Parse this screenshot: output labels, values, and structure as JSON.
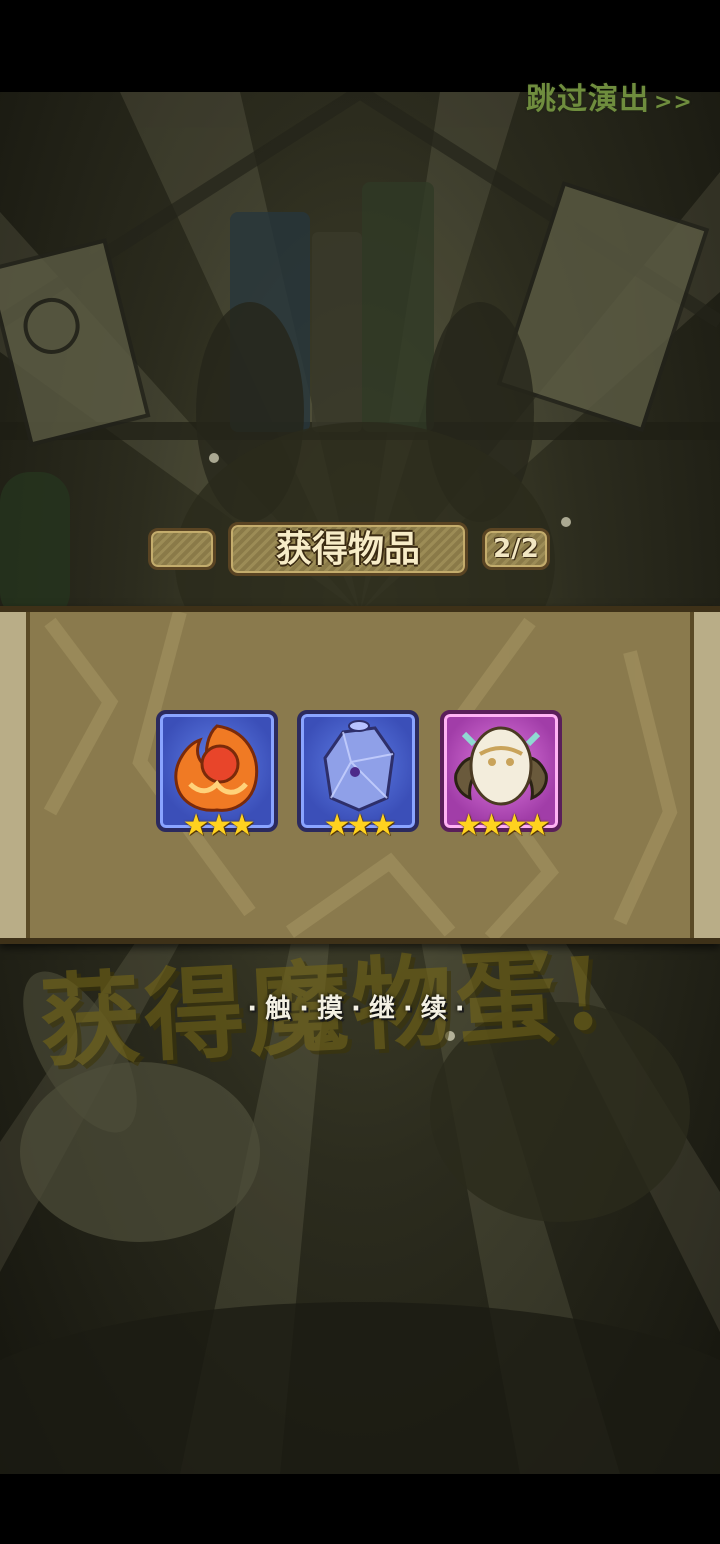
{
  "header": {
    "skip_label": "跳过演出",
    "skip_arrows": ">>"
  },
  "reward_panel": {
    "title": "获得物品",
    "page_counter": "2/2",
    "items": [
      {
        "icon": "fire-essence-icon",
        "rarity": "blue",
        "stars": "★★★",
        "star_count": 3
      },
      {
        "icon": "crystal-stone-icon",
        "rarity": "blue",
        "stars": "★★★",
        "star_count": 3
      },
      {
        "icon": "winged-egg-icon",
        "rarity": "pink",
        "stars": "★★★★",
        "star_count": 4
      }
    ]
  },
  "banner": {
    "background_text": "获得魔物蛋!",
    "continue_hint": "·触·摸·继·续·"
  },
  "colors": {
    "skip_green": "#6f8d3e",
    "panel_tan": "#8a7a4d",
    "star_gold": "#ffd21f",
    "rarity_blue": "#3b4fb8",
    "rarity_pink": "#a13da8"
  }
}
